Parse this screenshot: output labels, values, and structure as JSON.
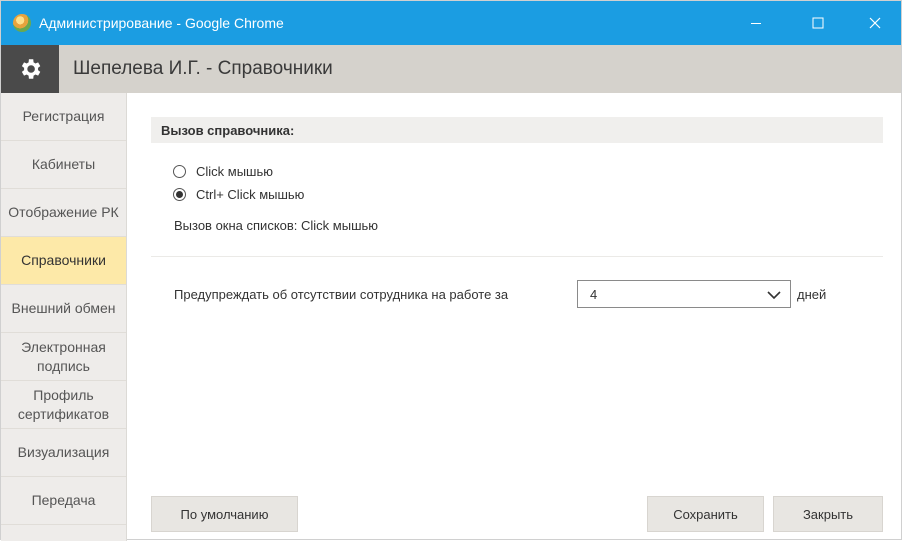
{
  "window": {
    "title": "Администрирование - Google Chrome",
    "title_bar_color": "#1b9de2"
  },
  "header": {
    "title": "Шепелева И.Г. - Справочники",
    "icon": "gear-icon"
  },
  "sidebar": {
    "items": [
      {
        "label": "Регистрация"
      },
      {
        "label": "Кабинеты"
      },
      {
        "label": "Отображение РК"
      },
      {
        "label": "Справочники",
        "active": true
      },
      {
        "label": "Внешний обмен"
      },
      {
        "label": "Электронная подпись"
      },
      {
        "label": "Профиль сертификатов"
      },
      {
        "label": "Визуализация"
      },
      {
        "label": "Передача"
      }
    ],
    "active_color": "#fde9a8"
  },
  "main": {
    "section_title": "Вызов справочника:",
    "radio_options": [
      {
        "label": "Click мышью",
        "checked": false
      },
      {
        "label": "Ctrl+ Click мышью",
        "checked": true
      }
    ],
    "list_call_text": "Вызов окна списков:  Click мышью",
    "warn_label": "Предупреждать об отсутствии сотрудника на работе за",
    "warn_value": "4",
    "warn_unit": "дней"
  },
  "buttons": {
    "default_label": "По умолчанию",
    "save_label": "Сохранить",
    "close_label": "Закрыть"
  }
}
